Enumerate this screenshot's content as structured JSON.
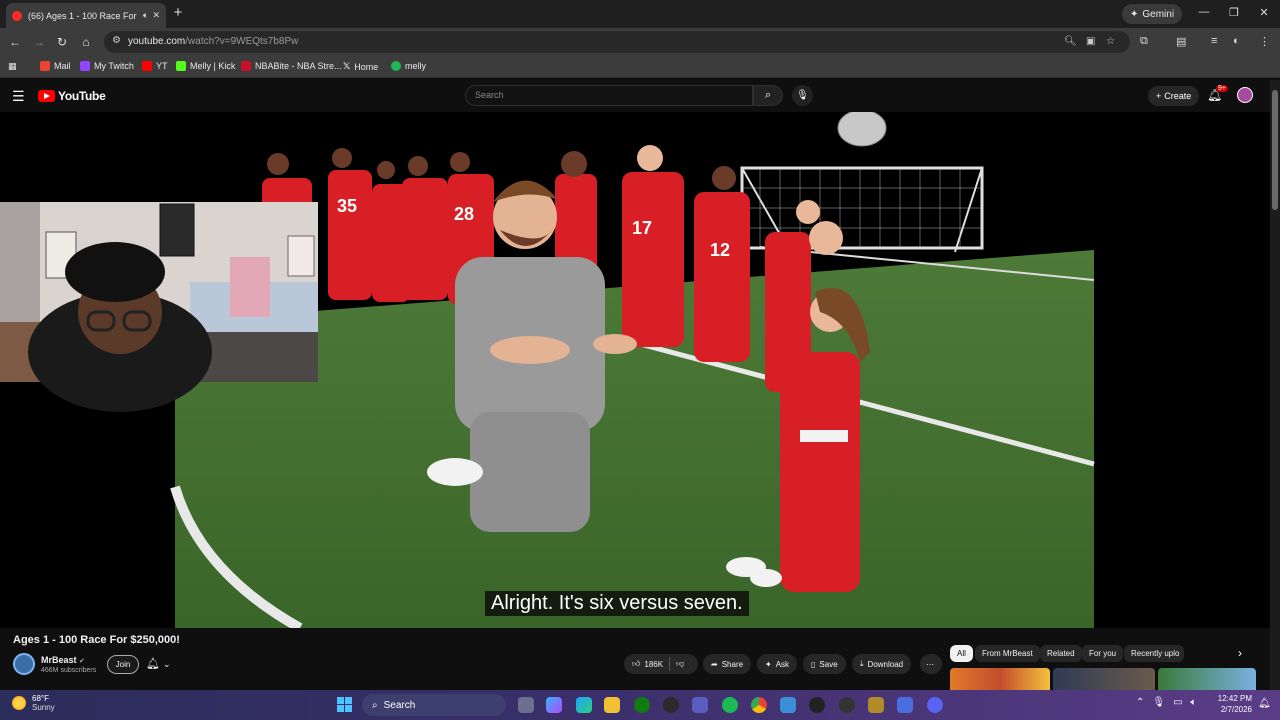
{
  "browser": {
    "tab": {
      "title": "(66) Ages 1 - 100 Race For $"
    },
    "gemini_label": "Gemini",
    "url": {
      "domain": "youtube.com",
      "path": "/watch?v=9WEQts7b8Pw"
    },
    "bookmarks": [
      {
        "label": "Mail",
        "color": "#ea4335"
      },
      {
        "label": "My Twitch",
        "color": "#9146ff"
      },
      {
        "label": "YT",
        "color": "#ff0000"
      },
      {
        "label": "Melly | Kick",
        "color": "#53fc18"
      },
      {
        "label": "NBABite - NBA Stre...",
        "color": "#c8102e"
      },
      {
        "label": "Home",
        "color": "#ffffff"
      },
      {
        "label": "melly",
        "color": "#1db954"
      }
    ]
  },
  "youtube": {
    "logo_text": "YouTube",
    "search_placeholder": "Search",
    "create_label": "Create",
    "notifications_badge": "9+",
    "video": {
      "subtitle": "Alright. It's six versus seven.",
      "title": "Ages 1 - 100 Race For $250,000!",
      "channel": "MrBeast",
      "verified_icon": "verified-check-icon",
      "subscribers": "466M subscribers",
      "join_label": "Join",
      "likes": "186K",
      "share_label": "Share",
      "ask_label": "Ask",
      "save_label": "Save",
      "download_label": "Download"
    },
    "chips": [
      "All",
      "From MrBeast",
      "Related",
      "For you",
      "Recently uplo"
    ]
  },
  "taskbar": {
    "weather": {
      "temp": "68°F",
      "condition": "Sunny"
    },
    "search_label": "Search",
    "clock": {
      "time": "12:42 PM",
      "date": "2/7/2026"
    }
  },
  "colors": {
    "accent_red": "#ff0000",
    "jersey_red": "#d91f26",
    "field_green": "#3f6b2d"
  }
}
